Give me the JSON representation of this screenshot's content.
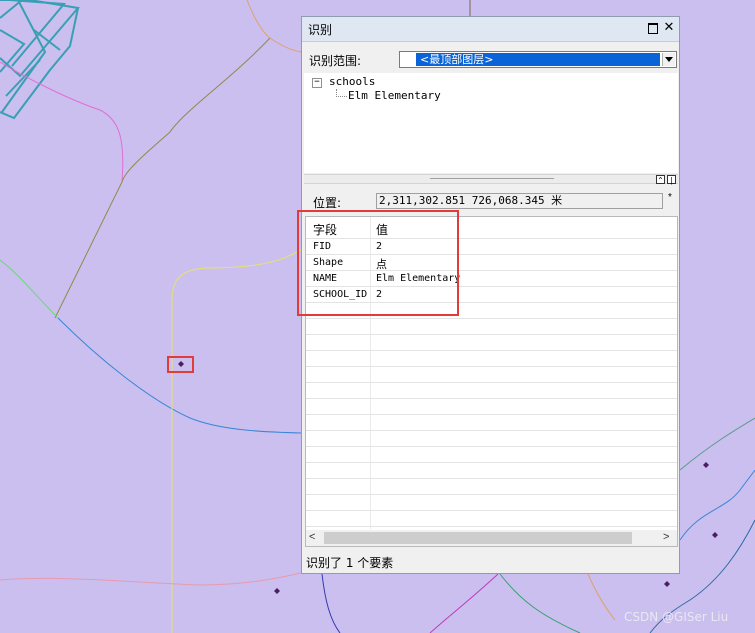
{
  "window": {
    "title": "识别",
    "scope_label": "识别范围:",
    "scope_value": "<最顶部图层>",
    "tree": {
      "expand_symbol": "−",
      "layer": "schools",
      "feature": "Elm Elementary"
    },
    "position_label": "位置:",
    "position_value": "2,311,302.851  726,068.345 米",
    "table": {
      "header": {
        "field": "字段",
        "value": "值"
      },
      "rows": [
        {
          "field": "FID",
          "value": "2"
        },
        {
          "field": "Shape",
          "value": "点"
        },
        {
          "field": "NAME",
          "value": "Elm Elementary"
        },
        {
          "field": "SCHOOL_ID",
          "value": "2"
        }
      ]
    },
    "status": "识别了 1 个要素"
  },
  "map": {
    "background_color": "#cabfee",
    "point_color": "#4b1e63"
  },
  "watermark": "CSDN @GISer Liu",
  "colors": {
    "highlight": "#e23b3b",
    "selection": "#0a64d8"
  }
}
